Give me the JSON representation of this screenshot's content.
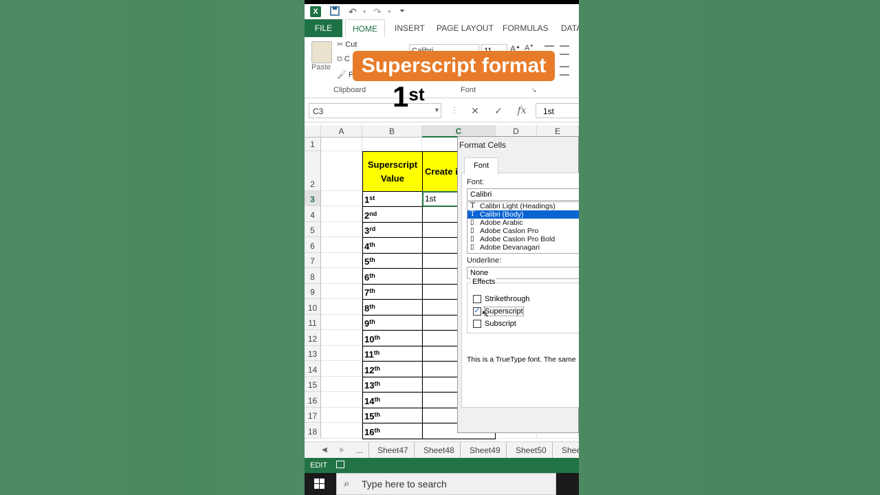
{
  "qat": {
    "icons": [
      "excel-icon",
      "save-icon",
      "undo-icon",
      "redo-icon",
      "customize-icon"
    ]
  },
  "ribbon_tabs": [
    {
      "label": "FILE"
    },
    {
      "label": "HOME"
    },
    {
      "label": "INSERT"
    },
    {
      "label": "PAGE LAYOUT"
    },
    {
      "label": "FORMULAS"
    },
    {
      "label": "DATA"
    }
  ],
  "clipboard": {
    "paste_label": "Paste",
    "cut_label": "Cut",
    "copy_label": "C",
    "format_label": "F",
    "group_label": "Clipboard"
  },
  "font_group": {
    "font_name": "Calibri",
    "font_size": "11",
    "group_label": "Font"
  },
  "overlay": {
    "banner": "Superscript format",
    "example_base": "1",
    "example_sup": "st"
  },
  "formula_bar": {
    "name_box": "C3",
    "content": "1st",
    "fx": "fx"
  },
  "columns": [
    "A",
    "B",
    "C",
    "D",
    "E"
  ],
  "rows": [
    "1",
    "2",
    "3",
    "4",
    "5",
    "6",
    "7",
    "8",
    "9",
    "10",
    "11",
    "12",
    "13",
    "14",
    "15",
    "16",
    "17",
    "18"
  ],
  "table": {
    "header_b": "Superscript Value",
    "header_c": "Create i",
    "values": [
      {
        "n": "1",
        "s": "st"
      },
      {
        "n": "2",
        "s": "nd"
      },
      {
        "n": "3",
        "s": "rd"
      },
      {
        "n": "4",
        "s": "th"
      },
      {
        "n": "5",
        "s": "th"
      },
      {
        "n": "6",
        "s": "th"
      },
      {
        "n": "7",
        "s": "th"
      },
      {
        "n": "8",
        "s": "th"
      },
      {
        "n": "9",
        "s": "th"
      },
      {
        "n": "10",
        "s": "th"
      },
      {
        "n": "11",
        "s": "th"
      },
      {
        "n": "12",
        "s": "th"
      },
      {
        "n": "13",
        "s": "th"
      },
      {
        "n": "14",
        "s": "th"
      },
      {
        "n": "15",
        "s": "th"
      },
      {
        "n": "16",
        "s": "th"
      }
    ],
    "c3_value": "1st"
  },
  "dialog": {
    "title": "Format Cells",
    "tab": "Font",
    "font_label": "Font:",
    "font_value": "Calibri",
    "font_list": [
      "Calibri Light (Headings)",
      "Calibri (Body)",
      "Adobe Arabic",
      "Adobe Caslon Pro",
      "Adobe Caslon Pro Bold",
      "Adobe Devanagari"
    ],
    "selected_font_index": 1,
    "underline_label": "Underline:",
    "underline_value": "None",
    "effects_label": "Effects",
    "effects": [
      {
        "label": "Strikethrough",
        "checked": false
      },
      {
        "label": "Superscript",
        "checked": true
      },
      {
        "label": "Subscript",
        "checked": false
      }
    ],
    "truetype_note": "This is a TrueType font.  The same"
  },
  "sheet_tabs": [
    "...",
    "Sheet47",
    "Sheet48",
    "Sheet49",
    "Sheet50",
    "Shee"
  ],
  "status": {
    "mode": "EDIT"
  },
  "taskbar": {
    "search_placeholder": "Type here to search"
  }
}
